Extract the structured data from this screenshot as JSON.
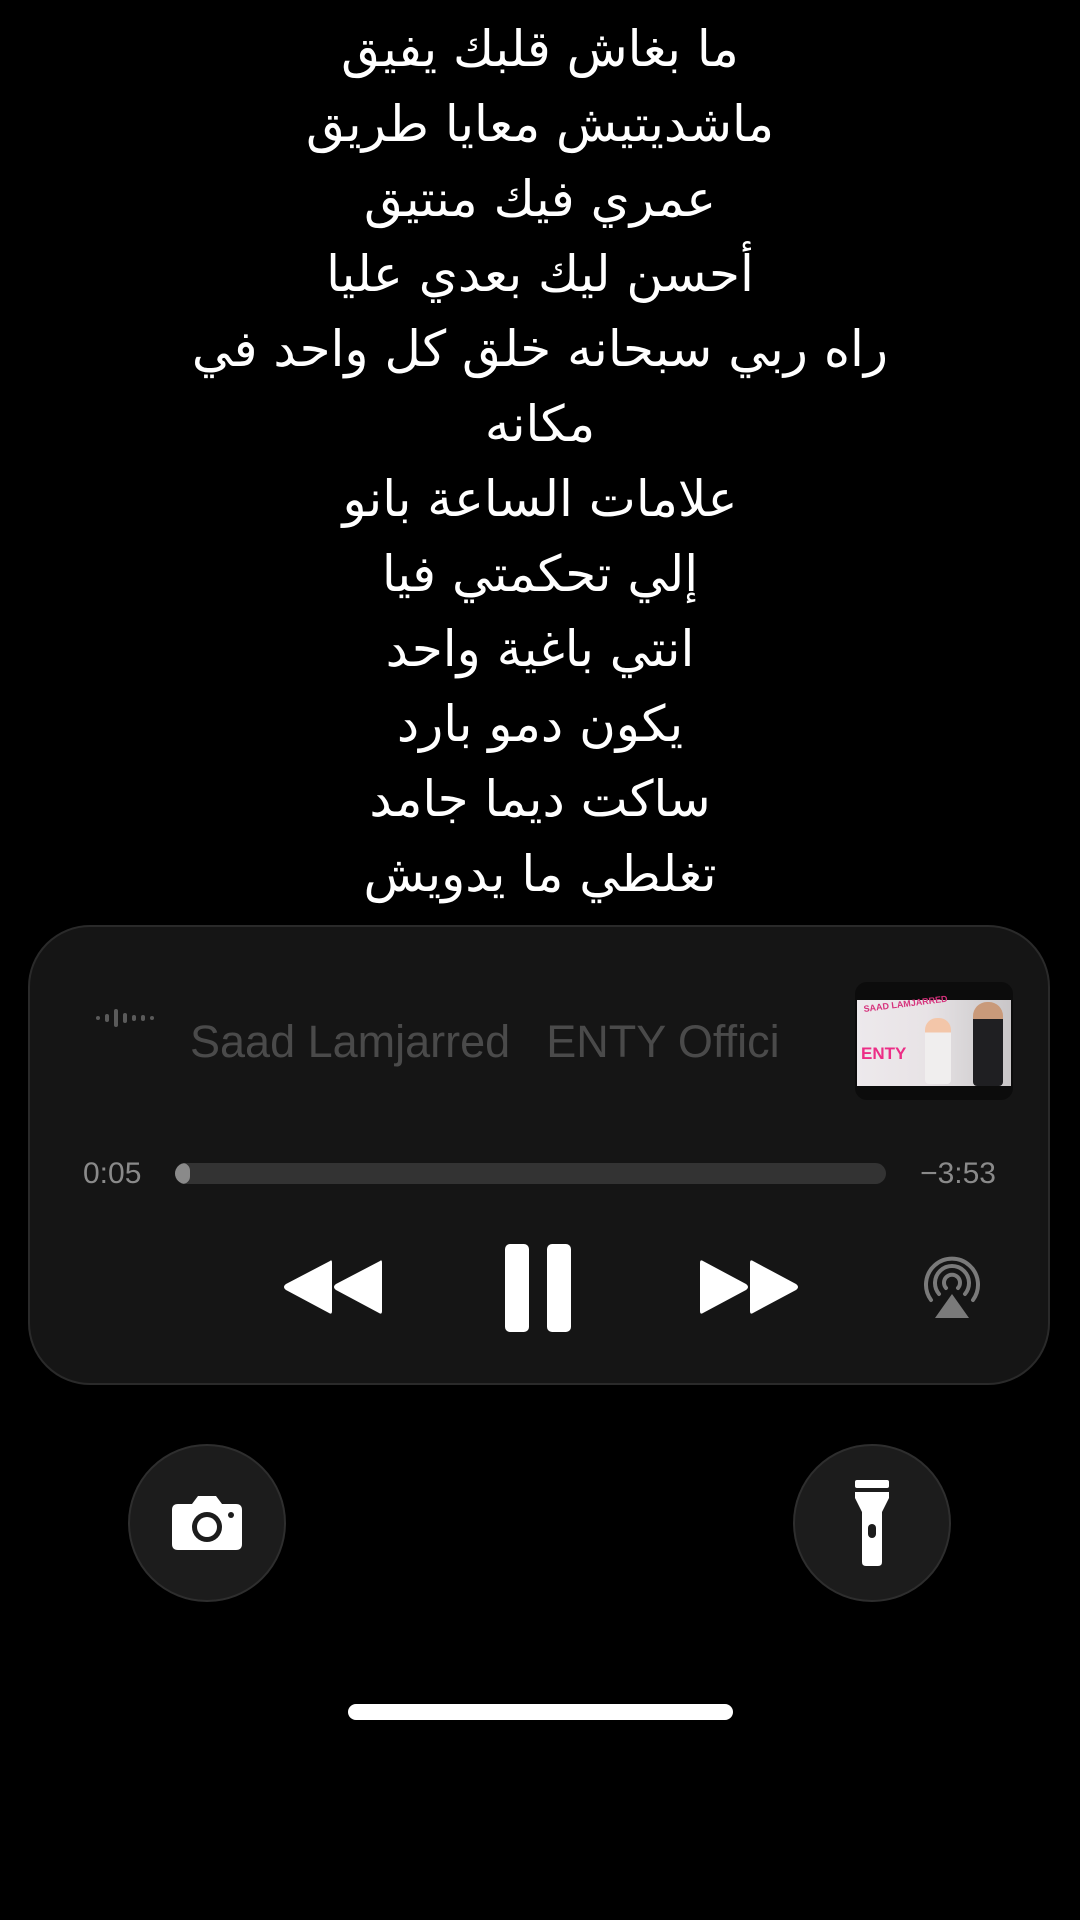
{
  "lyrics": [
    "ما بغاش قلبك يفيق",
    "ماشديتيش معايا طريق",
    "عمري فيك منتيق",
    "أحسن ليك بعدي عليا",
    "راه ربي سبحانه خلق كل واحد في",
    "مكانه",
    "علامات الساعة بانو",
    "إلي تحكمتي فيا",
    "انتي باغية واحد",
    "يكون دمو بارد",
    "ساكت ديما جامد",
    "تغلطي ما يدويش"
  ],
  "now_playing": {
    "artist": "Saad Lamjarred",
    "title": "ENTY Offici",
    "album_art": {
      "artist_text": "SAAD LAMJARRED",
      "title_text": "ENTY"
    },
    "elapsed": "0:05",
    "remaining": "−3:53",
    "progress_fraction": 0.021,
    "icons": {
      "waveform": "waveform-icon",
      "rewind": "rewind-icon",
      "pause": "pause-icon",
      "forward": "fast-forward-icon",
      "airplay": "airplay-icon"
    }
  },
  "quick_actions": {
    "left_icon": "camera-icon",
    "right_icon": "flashlight-icon"
  },
  "colors": {
    "background": "#000000",
    "lyrics_text": "#ffffff",
    "card": "#151515",
    "muted_text": "#8a8a8a",
    "marquee_text": "#4a4a4a",
    "accent_pink": "#ec2d86"
  }
}
